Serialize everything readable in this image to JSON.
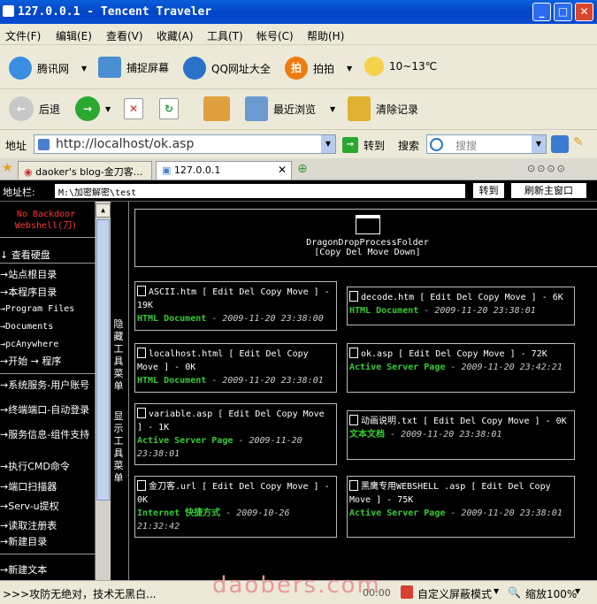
{
  "window": {
    "title": "127.0.0.1 - Tencent Traveler"
  },
  "menu": [
    "文件(F)",
    "编辑(E)",
    "查看(V)",
    "收藏(A)",
    "工具(T)",
    "帐号(C)",
    "帮助(H)"
  ],
  "toolbar1": {
    "tencent": "腾讯网",
    "capture": "捕捉屏幕",
    "qqurls": "QQ网址大全",
    "pai": "拍拍",
    "weather": "10~13℃"
  },
  "toolbar2": {
    "back": "后退",
    "recent": "最近浏览",
    "clear": "清除记录"
  },
  "address": {
    "label": "地址",
    "url": "http://localhost/ok.asp",
    "go": "转到",
    "search_label": "搜索",
    "search_placeholder": "搜搜"
  },
  "tabs": [
    {
      "title": "daoker's blog-金刀客..."
    },
    {
      "title": "127.0.0.1"
    }
  ],
  "shell": {
    "addr_label": "地址栏:",
    "path": "M:\\加密解密\\test",
    "go_button": "转到",
    "refresh_button": "刷新主窗口",
    "brand_line1": "No Backdoor",
    "brand_line2": "Webshell(刀)",
    "side_items": [
      "查看硬盘",
      "站点根目录",
      "本程序目录",
      "Program Files",
      "Documents",
      "pcAnywhere",
      "开始 → 程序",
      "系统服务-用户账号",
      "终端端口-自动登录",
      "服务信息-组件支持",
      "执行CMD命令",
      "端口扫描器",
      "Serv-u提权",
      "读取注册表",
      "新建目录",
      "新建文本"
    ],
    "hide_tools": "隐藏工具菜单",
    "show_tools": "显示工具菜单",
    "folder": {
      "name": "DragonDropProcessFolder",
      "actions": "[Copy Del Move Down]"
    },
    "files": [
      {
        "name": "ASCII.htm",
        "actions": "[ Edit Del Copy Move ]",
        "size": "- 19K",
        "type": "HTML Document",
        "date": "- 2009-11-20 23:38:00"
      },
      {
        "name": "decode.htm",
        "actions": "[ Edit Del Copy Move ]",
        "size": "- 6K",
        "type": "HTML Document",
        "date": "- 2009-11-20 23:38:01"
      },
      {
        "name": "localhost.html",
        "actions": "[ Edit Del Copy Move ]",
        "size": "- 0K",
        "type": "HTML Document",
        "date": "- 2009-11-20 23:38:01"
      },
      {
        "name": "ok.asp",
        "actions": "[ Edit Del Copy Move ]",
        "size": "- 72K",
        "type": "Active Server Page",
        "date": "- 2009-11-20 23:42:21"
      },
      {
        "name": "variable.asp",
        "actions": "[ Edit Del Copy Move ]",
        "size": "- 1K",
        "type": "Active Server Page",
        "date": "- 2009-11-20 23:38:01"
      },
      {
        "name": "动画说明.txt",
        "actions": "[ Edit Del Copy Move ]",
        "size": "- 0K",
        "type": "文本文档",
        "date": "- 2009-11-20 23:38:01"
      },
      {
        "name": "金刀客.url",
        "actions": "[ Edit Del Copy Move ]",
        "size": "- 0K",
        "type": "Internet 快捷方式",
        "date": "- 2009-10-26 21:32:42"
      },
      {
        "name": "黑鹰专用WEBSHELL .asp",
        "actions": "[ Edit Del Copy Move ]",
        "size": "- 75K",
        "type": "Active Server Page",
        "date": "- 2009-11-20 23:38:01"
      }
    ]
  },
  "status": {
    "text": ">>>攻防无绝对，技术无黑白...",
    "watermark": "daobers.com",
    "time": "00:00",
    "mode": "自定义屏蔽模式",
    "zoom": "缩放100%"
  },
  "colors": {
    "title_blue": "#0346c9",
    "shell_bg": "#000000",
    "brand_red": "#ff3333",
    "type_green": "#33cc33"
  }
}
